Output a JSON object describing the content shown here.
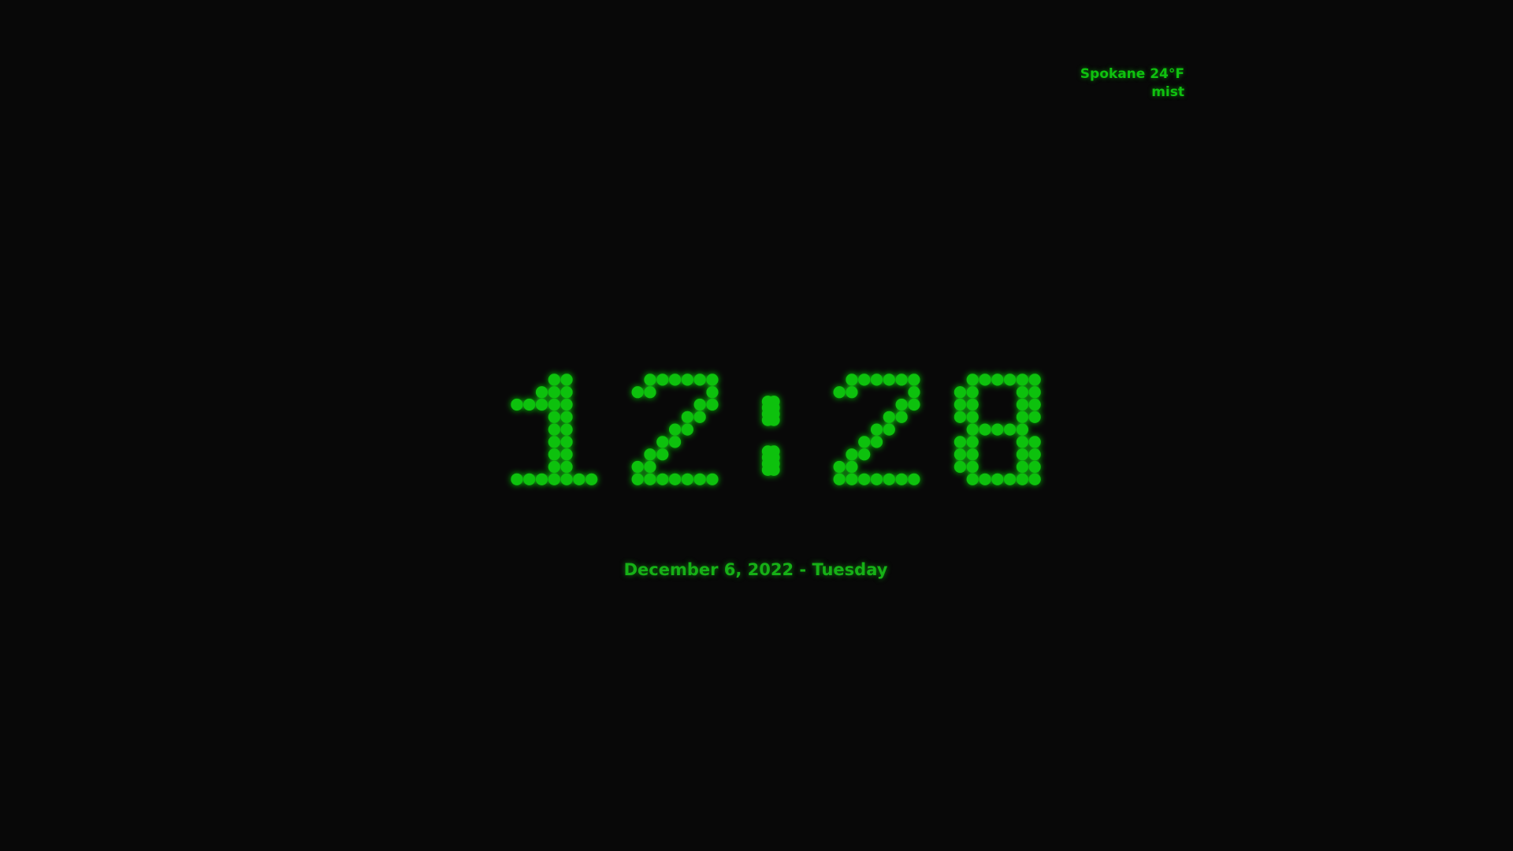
{
  "weather": {
    "location_temp": "Spokane 24°F",
    "condition": "mist"
  },
  "clock": {
    "time": "12:28"
  },
  "date": {
    "text": "December 6, 2022 - Tuesday"
  },
  "colors": {
    "background": "#080808",
    "led_green": "#0fc10f",
    "glow_green": "#22ff22"
  }
}
